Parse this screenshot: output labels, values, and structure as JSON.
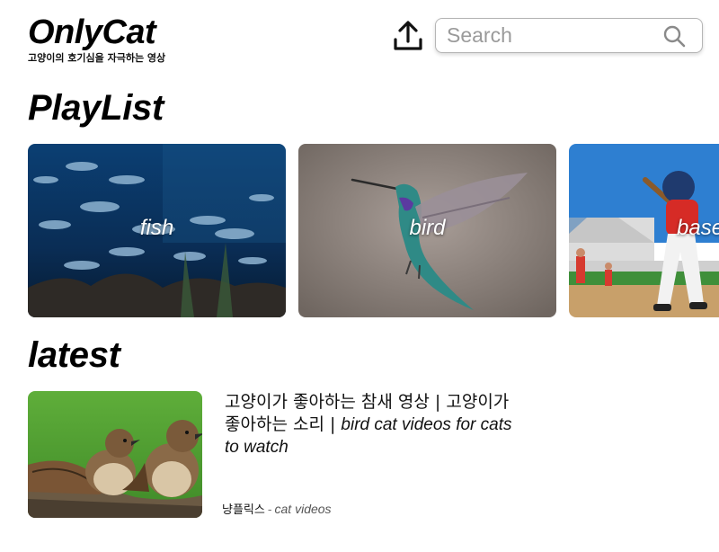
{
  "header": {
    "logo_title": "OnlyCat",
    "logo_tagline": "고양이의 호기심을 자극하는 영상",
    "upload_icon": "upload-icon",
    "search": {
      "placeholder": "Search",
      "value": "",
      "icon": "search-icon"
    }
  },
  "playlist": {
    "title": "PlayList",
    "items": [
      {
        "label": "fish"
      },
      {
        "label": "bird"
      },
      {
        "label": "baseball"
      }
    ]
  },
  "latest": {
    "title": "latest",
    "videos": [
      {
        "title_ko": "고양이가 좋아하는 참새 영상 | 고양이가 좋아하는 소리 | ",
        "title_en": "bird cat videos for cats to watch",
        "channel": "냥플릭스",
        "separator": "-",
        "category": "cat videos"
      }
    ]
  }
}
